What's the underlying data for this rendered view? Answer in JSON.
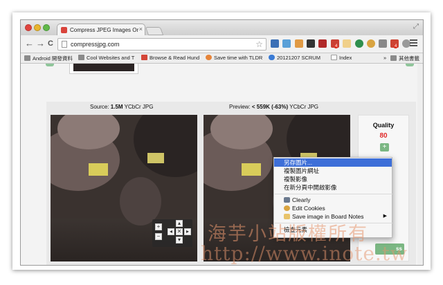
{
  "browser": {
    "tab_title": "Compress JPEG Images Or",
    "tab_close": "×",
    "url": "compressjpg.com",
    "back_glyph": "←",
    "forward_glyph": "→",
    "reload_glyph": "C",
    "star_glyph": "☆",
    "resize_glyph": "⤢"
  },
  "bookmarks": [
    {
      "label": "Android 開發資料",
      "icon": "folder-icon",
      "color": "#8a8a8a"
    },
    {
      "label": "Cool Websites and T",
      "icon": "folder-icon",
      "color": "#8a8a8a"
    },
    {
      "label": "Browse & Read Hund",
      "icon": "gmail-icon",
      "color": "#d44638"
    },
    {
      "label": "Save time with TLDR",
      "icon": "tldr-icon",
      "color": "#e6843a"
    },
    {
      "label": "20121207 SCRUM",
      "icon": "cloud-icon",
      "color": "#3a7bd5"
    },
    {
      "label": "Index",
      "icon": "page-icon",
      "color": "#ffffff"
    }
  ],
  "bookmarks_overflow": "»",
  "bookmarks_other": "其他書籤",
  "source": {
    "prefix": "Source: ",
    "size": "1.5M",
    "suffix": " YCbCr JPG"
  },
  "preview": {
    "prefix": "Preview: ",
    "size": "< 559K (-63%)",
    "suffix": " YCbCr JPG"
  },
  "zoom": {
    "plus": "+",
    "minus": "−",
    "up": "▴",
    "down": "▾",
    "left": "◂",
    "right": "▸",
    "reset": "✕"
  },
  "quality": {
    "label": "Quality",
    "value": "80",
    "plus": "+",
    "button": "ss"
  },
  "context_menu": {
    "items": [
      {
        "label": "另存圖片...",
        "selected": true
      },
      {
        "label": "複製圖片網址"
      },
      {
        "label": "複製影像"
      },
      {
        "label": "在新分頁中開啟影像"
      },
      {
        "label": "Clearly",
        "icon": "clearly-icon"
      },
      {
        "label": "Edit Cookies",
        "icon": "cookie-icon"
      },
      {
        "label": "Save image in Board Notes",
        "icon": "board-notes-icon",
        "arrow": "▶"
      },
      {
        "label": "檢查元素"
      }
    ]
  },
  "watermark": {
    "line1": "海芋小站版權所有",
    "line2": "http://www.inote.tw"
  }
}
